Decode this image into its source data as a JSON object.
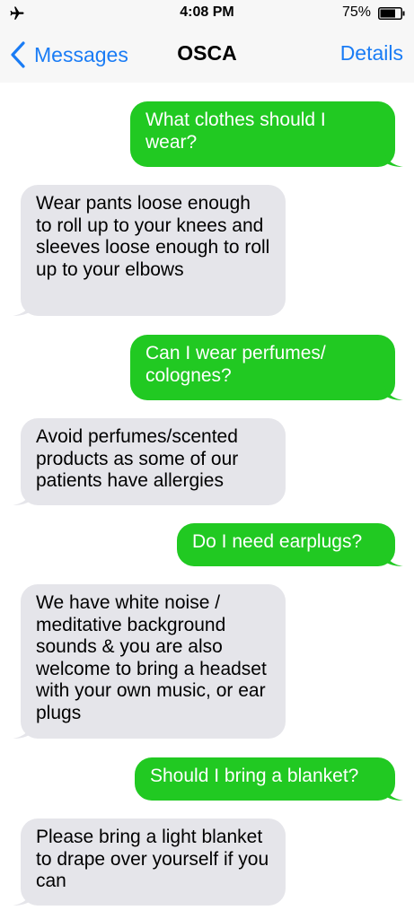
{
  "status_bar": {
    "time": "4:08 PM",
    "battery_percent": "75%",
    "battery_level": 0.75,
    "airplane_icon": "airplane-icon"
  },
  "nav": {
    "back_label": "Messages",
    "title": "OSCA",
    "details_label": "Details"
  },
  "colors": {
    "outgoing": "#21c922",
    "incoming": "#e5e5ea",
    "accent": "#1a7cf5"
  },
  "messages": [
    {
      "direction": "outgoing",
      "text": "What clothes should I wear?"
    },
    {
      "direction": "incoming",
      "text": "Wear pants loose enough to roll up to your knees and sleeves loose enough to roll up to your elbows"
    },
    {
      "direction": "outgoing",
      "text": "Can I wear perfumes/ colognes?"
    },
    {
      "direction": "incoming",
      "text": "Avoid perfumes/scented products as some of our patients have allergies"
    },
    {
      "direction": "outgoing",
      "text": "Do I need earplugs?"
    },
    {
      "direction": "incoming",
      "text": "We have white noise / meditative background sounds & you are also welcome to bring a headset with your own music, or ear plugs"
    },
    {
      "direction": "outgoing",
      "text": "Should I bring a blanket?"
    },
    {
      "direction": "incoming",
      "text": "Please bring a light blanket to drape over yourself if you can"
    }
  ]
}
